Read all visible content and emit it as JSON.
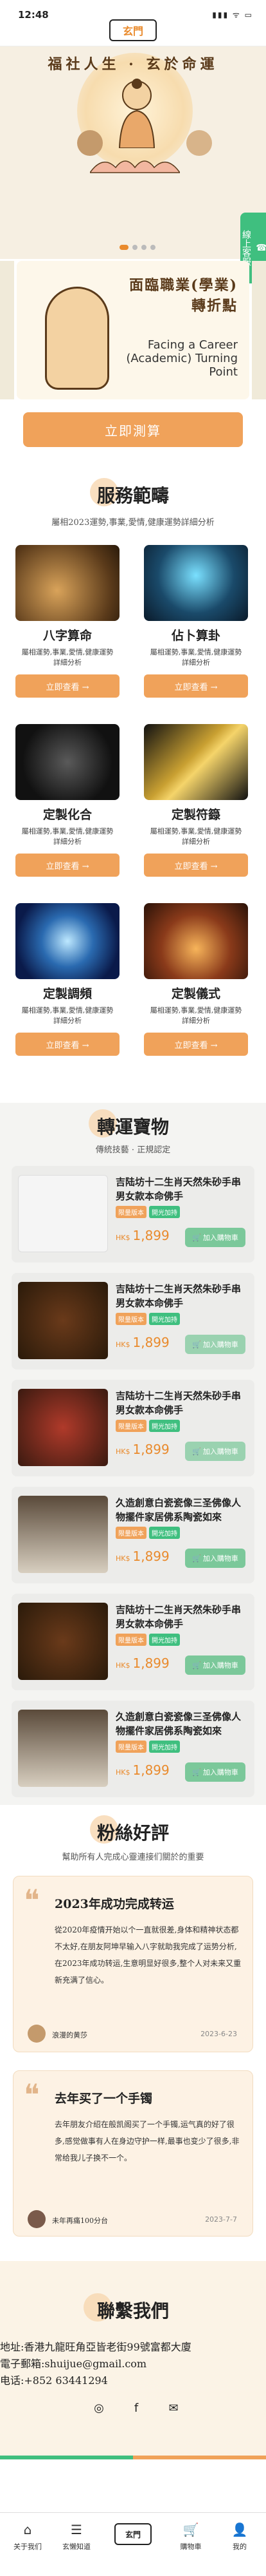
{
  "status": {
    "time": "12:48",
    "indicators": "▮▮▮ ᯤ ▭"
  },
  "brand": {
    "logo": "玄門"
  },
  "hero": {
    "slogan": "福社人生 · 玄於命運",
    "side_tab": "線上客服",
    "banner_title": "面臨職業(學業)轉折點",
    "banner_subtitle": "Facing a Career (Academic) Turning Point"
  },
  "cta": {
    "label": "立即測算"
  },
  "services": {
    "title": "服務範疇",
    "subtitle": "屬相2023運勢,事業,愛情,健康運勢詳細分析",
    "items": [
      {
        "name": "八字算命",
        "desc": "屬相運勢,事業,愛情,健康運勢詳細分析",
        "button": "立即查看 →"
      },
      {
        "name": "佔卜算卦",
        "desc": "屬相運勢,事業,愛情,健康運勢詳細分析",
        "button": "立即查看 →"
      },
      {
        "name": "定製化合",
        "desc": "屬相運勢,事業,愛情,健康運勢詳細分析",
        "button": "立即查看 →"
      },
      {
        "name": "定製符籙",
        "desc": "屬相運勢,事業,愛情,健康運勢詳細分析",
        "button": "立即查看 →"
      },
      {
        "name": "定製調頻",
        "desc": "屬相運勢,事業,愛情,健康運勢詳細分析",
        "button": "立即查看 →"
      },
      {
        "name": "定製儀式",
        "desc": "屬相運勢,事業,愛情,健康運勢詳細分析",
        "button": "立即查看 →"
      }
    ]
  },
  "gifts": {
    "title": "轉運寶物",
    "subtitle": "傳統技藝 · 正規認定",
    "tag_a": "限量版本",
    "tag_b": "開光加持",
    "currency": "HK$",
    "cart_label": "加入購物車",
    "items": [
      {
        "name": "吉陆坊十二生肖天然朱砂手串男女款本命佛手",
        "price": "1,899"
      },
      {
        "name": "吉陆坊十二生肖天然朱砂手串男女款本命佛手",
        "price": "1,899"
      },
      {
        "name": "吉陆坊十二生肖天然朱砂手串男女款本命佛手",
        "price": "1,899"
      },
      {
        "name": "久造創意白瓷瓷像三圣佛像人物擺件家居佛系陶瓷如來",
        "price": "1,899"
      },
      {
        "name": "吉陆坊十二生肖天然朱砂手串男女款本命佛手",
        "price": "1,899"
      },
      {
        "name": "久造創意白瓷瓷像三圣佛像人物擺件家居佛系陶瓷如來",
        "price": "1,899"
      }
    ]
  },
  "reviews": {
    "title": "粉絲好評",
    "subtitle": "幫助所有人完成心靈連接们關於的重要",
    "items": [
      {
        "title": "2023年成功完成转运",
        "body": "從2020年疫情开始以个一直就很差,身体和精神状态都不太好,在朋友阿坤早输入八字就助我完成了运势分析,在2023年成功转运,生意明显好很多,整个人对未来又重新充满了信心。",
        "name": "浪漫的黄莎",
        "date": "2023-6-23"
      },
      {
        "title": "去年买了一个手镯",
        "body": "去年朋友介绍在般凯阁买了一个手镯,运气真的好了很多,感觉做事有人在身边守护一样,最事也变少了很多,非常给我儿子换不一个。",
        "name": "未年再痛100分台",
        "date": "2023-7-7"
      }
    ]
  },
  "contact": {
    "title": "聯繫我們",
    "address": "地址:香港九龍旺角亞皆老街99號富都大廈",
    "email": "電子郵箱:shuijue@gmail.com",
    "phone": "电话:+852 63441294"
  },
  "tabbar": [
    {
      "label": "关于我们",
      "icon": "⌂"
    },
    {
      "label": "玄懒知道",
      "icon": "☰"
    },
    {
      "label": "玄門",
      "icon": ""
    },
    {
      "label": "購物車",
      "icon": "🛒"
    },
    {
      "label": "我的",
      "icon": "👤"
    }
  ],
  "colors": {
    "accent": "#f0a25a",
    "green": "#3fbf7f",
    "cream": "#f6efe2"
  }
}
